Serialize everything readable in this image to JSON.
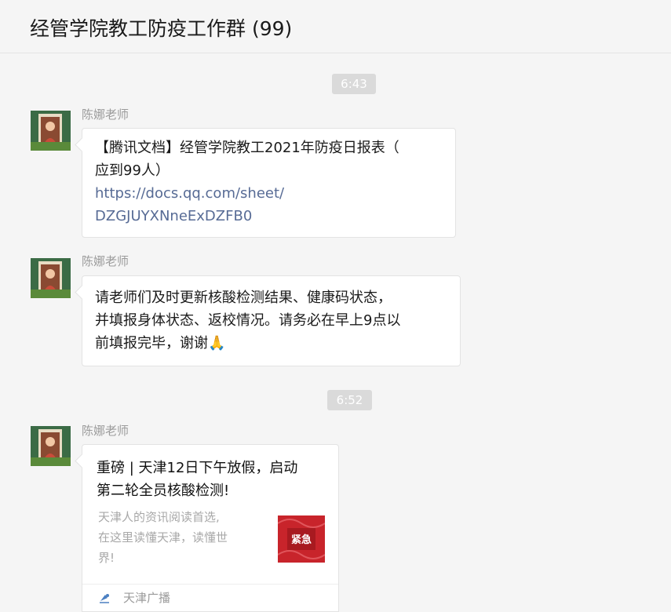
{
  "header": {
    "title": "经管学院教工防疫工作群 (99)"
  },
  "messages": [
    {
      "time": "6:43",
      "sender": "陈娜老师",
      "text_lines": [
        "【腾讯文档】经管学院教工2021年防疫日报表（",
        "应到99人）"
      ],
      "link_lines": [
        "https://docs.qq.com/sheet/",
        "DZGJUYXNneExDZFB0"
      ]
    },
    {
      "sender": "陈娜老师",
      "text_lines": [
        "请老师们及时更新核酸检测结果、健康码状态，",
        "并填报身体状态、返校情况。请务必在早上9点以",
        "前填报完毕，谢谢"
      ],
      "emoji": "🙏"
    },
    {
      "time": "6:52",
      "sender": "陈娜老师",
      "card": {
        "title_lines": [
          "重磅 | 天津12日下午放假，启动",
          "第二轮全员核酸检测!"
        ],
        "desc_lines": [
          "天津人的资讯阅读首选,",
          "在这里读懂天津，读懂世",
          "界!"
        ],
        "thumb_text": "紧急",
        "source": "天津广播",
        "source_icon": "broadcast-icon"
      }
    }
  ],
  "colors": {
    "background": "#f5f5f5",
    "link": "#576b95",
    "thumb_red": "#c8242b"
  }
}
